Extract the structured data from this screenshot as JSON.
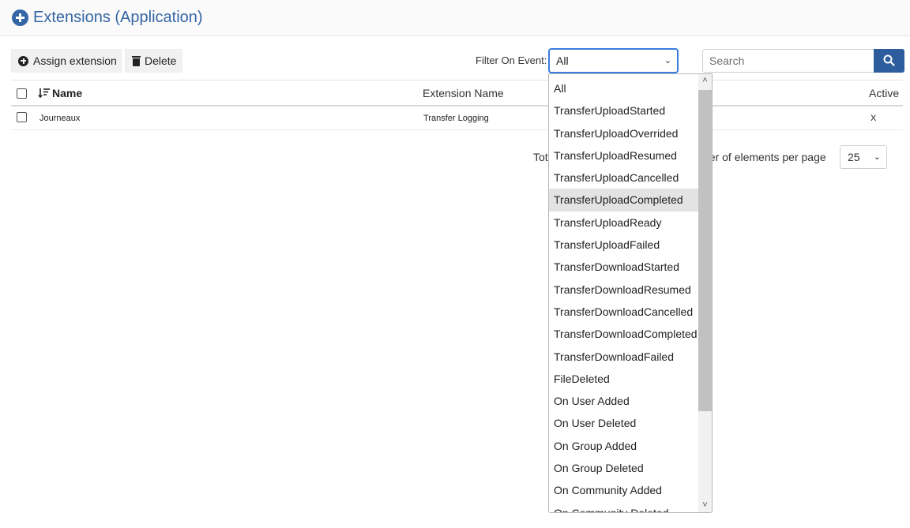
{
  "header": {
    "title": "Extensions (Application)"
  },
  "toolbar": {
    "assign_label": "Assign extension",
    "delete_label": "Delete",
    "filter_label": "Filter On Event:",
    "filter_value": "All",
    "search_placeholder": "Search"
  },
  "table": {
    "columns": {
      "name": "Name",
      "extension_name": "Extension Name",
      "active": "Active"
    },
    "rows": [
      {
        "name": "Journeaux",
        "extension_name": "Transfer Logging",
        "active": "X"
      }
    ]
  },
  "pager": {
    "total_text": "Tot",
    "per_page_text": "ber of elements per page",
    "page_size": "25"
  },
  "dropdown": {
    "hovered_index": 5,
    "options": [
      "All",
      "TransferUploadStarted",
      "TransferUploadOverrided",
      "TransferUploadResumed",
      "TransferUploadCancelled",
      "TransferUploadCompleted",
      "TransferUploadReady",
      "TransferUploadFailed",
      "TransferDownloadStarted",
      "TransferDownloadResumed",
      "TransferDownloadCancelled",
      "TransferDownloadCompleted",
      "TransferDownloadFailed",
      "FileDeleted",
      "On User Added",
      "On User Deleted",
      "On Group Added",
      "On Group Deleted",
      "On Community Added",
      "On Community Deleted"
    ]
  },
  "colors": {
    "accent": "#3465a4",
    "search_button": "#2e5d9e",
    "focus_border": "#3b7ddd"
  }
}
